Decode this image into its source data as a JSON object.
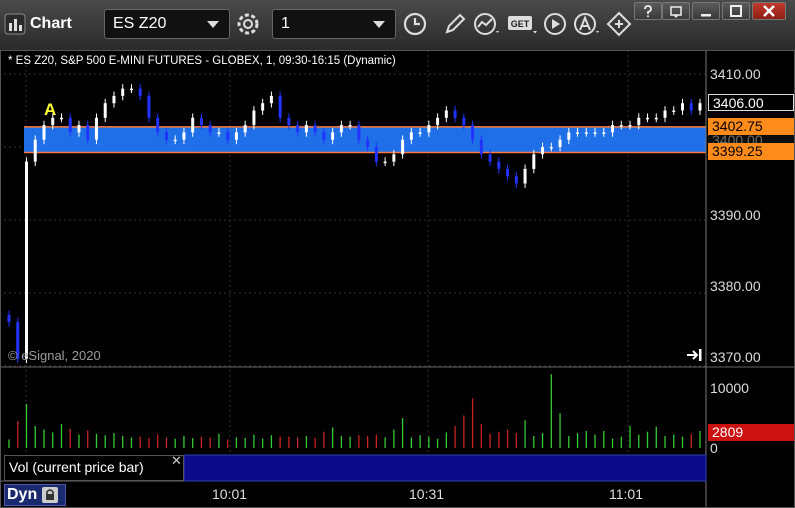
{
  "app": {
    "title": "Chart"
  },
  "toolbar": {
    "symbol": "ES Z20",
    "interval": "1"
  },
  "chart": {
    "instrument_label": "* ES Z20, S&P 500 E-MINI FUTURES - GLOBEX, 1, 09:30-16:15 (Dynamic)",
    "watermark": "© eSignal, 2020",
    "marker": "A",
    "price_axis": [
      "3410.00",
      "3390.00",
      "3380.00",
      "3370.00"
    ],
    "price_tags": {
      "last": "3406.00",
      "upper": "3402.75",
      "hidden": "3400.00",
      "lower": "3399.25"
    },
    "volume_axis": [
      "10000",
      "0"
    ],
    "volume_tag": "2809",
    "volume_legend": "Vol (current price bar)",
    "time_axis": [
      "10:01",
      "10:31",
      "11:01"
    ],
    "colors": {
      "up": "#ffffff",
      "down": "#2233ff",
      "band_fill": "#1e6fe8",
      "band_line": "#ff7a3c",
      "tag_orange": "#ff8c1a",
      "tag_red": "#cc1111",
      "vol_up": "#33cc33",
      "vol_down": "#cc2222"
    }
  },
  "chart_data": {
    "type": "bar",
    "title": "",
    "ylim": [
      3370,
      3412
    ],
    "band": [
      3399.25,
      3402.75
    ],
    "price_path": [
      3376,
      3371,
      3398,
      3401,
      3403,
      3404,
      3404,
      3402,
      3403,
      3401,
      3404,
      3406,
      3407,
      3408,
      3408,
      3407,
      3404,
      3402,
      3401,
      3401,
      3402,
      3404,
      3403,
      3402,
      3402,
      3401,
      3402,
      3403,
      3405,
      3406,
      3407,
      3404,
      3403,
      3402,
      3403,
      3402,
      3401,
      3402,
      3403,
      3403,
      3401,
      3400,
      3398,
      3398,
      3399,
      3401,
      3402,
      3402,
      3403,
      3404,
      3405,
      3404,
      3403,
      3401,
      3399,
      3398,
      3397,
      3396,
      3395,
      3397,
      3399,
      3400,
      3400,
      3401,
      3402,
      3402,
      3402,
      3402,
      3402,
      3403,
      3403,
      3403,
      3404,
      3404,
      3404,
      3405,
      3405,
      3406,
      3405,
      3406
    ],
    "volume_ylim": [
      0,
      11000
    ],
    "volume": [
      1200,
      3800,
      6200,
      3100,
      2600,
      2200,
      3400,
      2700,
      1900,
      2500,
      2000,
      1800,
      2100,
      1700,
      1500,
      1600,
      1400,
      1900,
      1500,
      1300,
      1700,
      1400,
      1600,
      1500,
      2000,
      1200,
      1500,
      1400,
      1900,
      1300,
      1800,
      1600,
      1600,
      1500,
      1700,
      1400,
      2300,
      2900,
      1700,
      1600,
      1800,
      1700,
      1900,
      1500,
      2600,
      4200,
      1500,
      1800,
      1600,
      1300,
      2200,
      3100,
      4600,
      7000,
      3400,
      2000,
      2300,
      2600,
      2100,
      3900,
      1700,
      2100,
      10400,
      4900,
      1700,
      2100,
      2400,
      1900,
      2400,
      1300,
      1600,
      3100,
      1900,
      2300,
      3000,
      1700,
      1900,
      1600,
      2000,
      2400
    ]
  }
}
